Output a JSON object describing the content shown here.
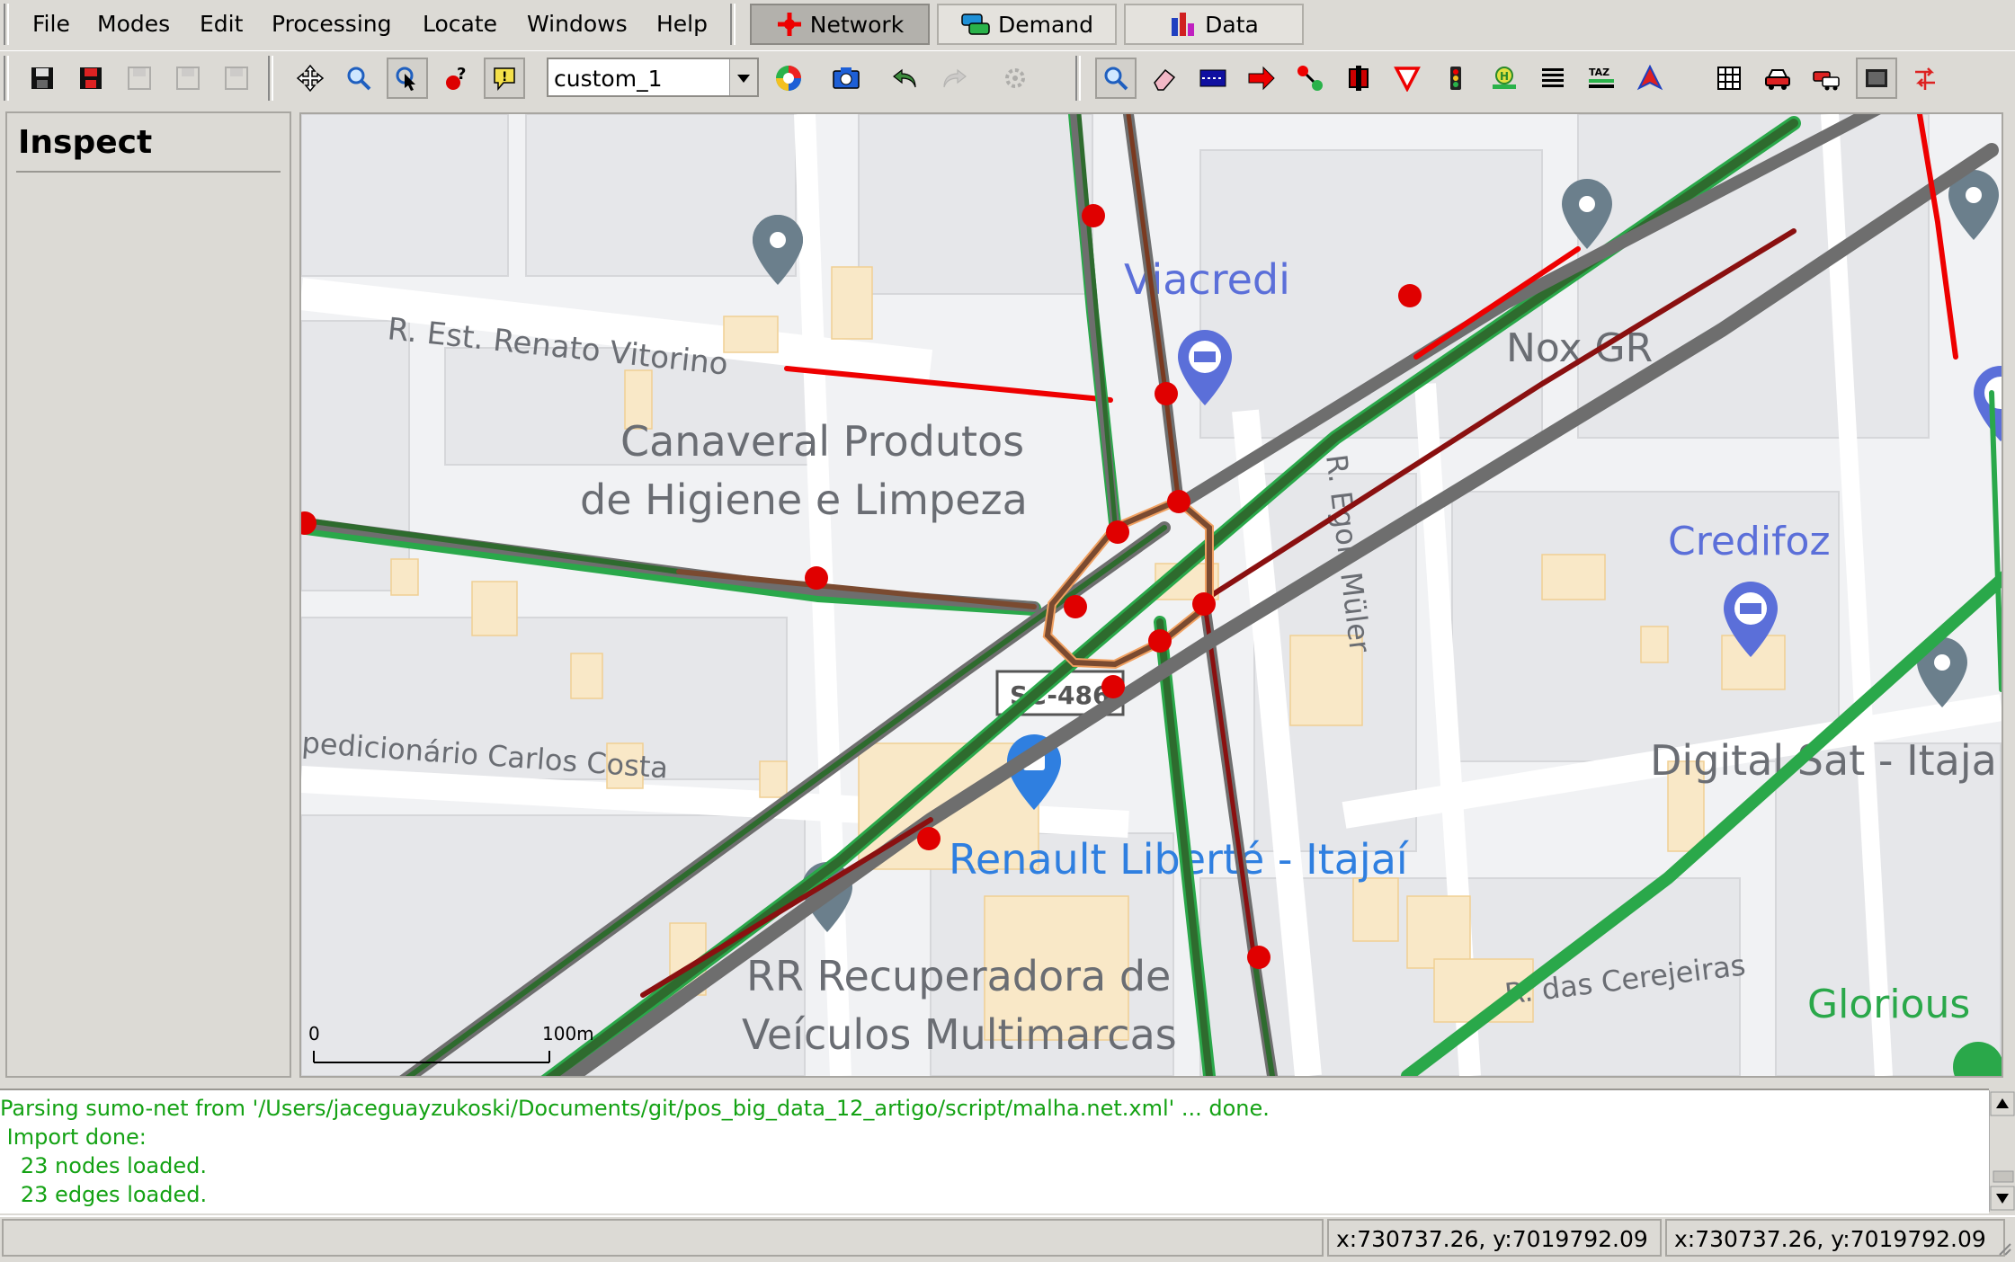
{
  "menu": {
    "file": "File",
    "modes": "Modes",
    "edit": "Edit",
    "processing": "Processing",
    "locate": "Locate",
    "windows": "Windows",
    "help": "Help"
  },
  "mode_tabs": {
    "network": "Network",
    "demand": "Demand",
    "data": "Data",
    "active": "Network"
  },
  "toolbar": {
    "scheme_value": "custom_1"
  },
  "inspect_panel": {
    "title": "Inspect"
  },
  "map": {
    "street_labels": [
      "R. Est. Renato Vitorino",
      "R. Egon Müler",
      "R. das Cerejeiras",
      "pedicionário Carlos Costa"
    ],
    "poi_labels": [
      "Viacredi",
      "Nox GR",
      "Canaveral Produtos",
      "de Higiene e Limpeza",
      "Credifoz",
      "Digital Sat - Itaja",
      "Renault Liberté - Itajaí",
      "RR Recuperadora de",
      "Veículos Multimarcas",
      "Glorious",
      "SC-486"
    ],
    "scale_left": "0",
    "scale_right": "100m"
  },
  "log": {
    "lines": [
      "Parsing sumo-net from '/Users/jaceguayzukoski/Documents/git/pos_big_data_12_artigo/script/malha.net.xml' ... done.",
      " Import done:",
      "   23 nodes loaded.",
      "   23 edges loaded."
    ]
  },
  "status": {
    "coord1": "x:730737.26, y:7019792.09",
    "coord2": "x:730737.26, y:7019792.09"
  },
  "colors": {
    "accent_active_tab": "#b3b1ac",
    "log_text": "#14a214",
    "node_red": "#e00000",
    "edge_gray": "#6e6e6e",
    "edge_green": "#2e6b2e",
    "edge_red": "#b00000"
  }
}
